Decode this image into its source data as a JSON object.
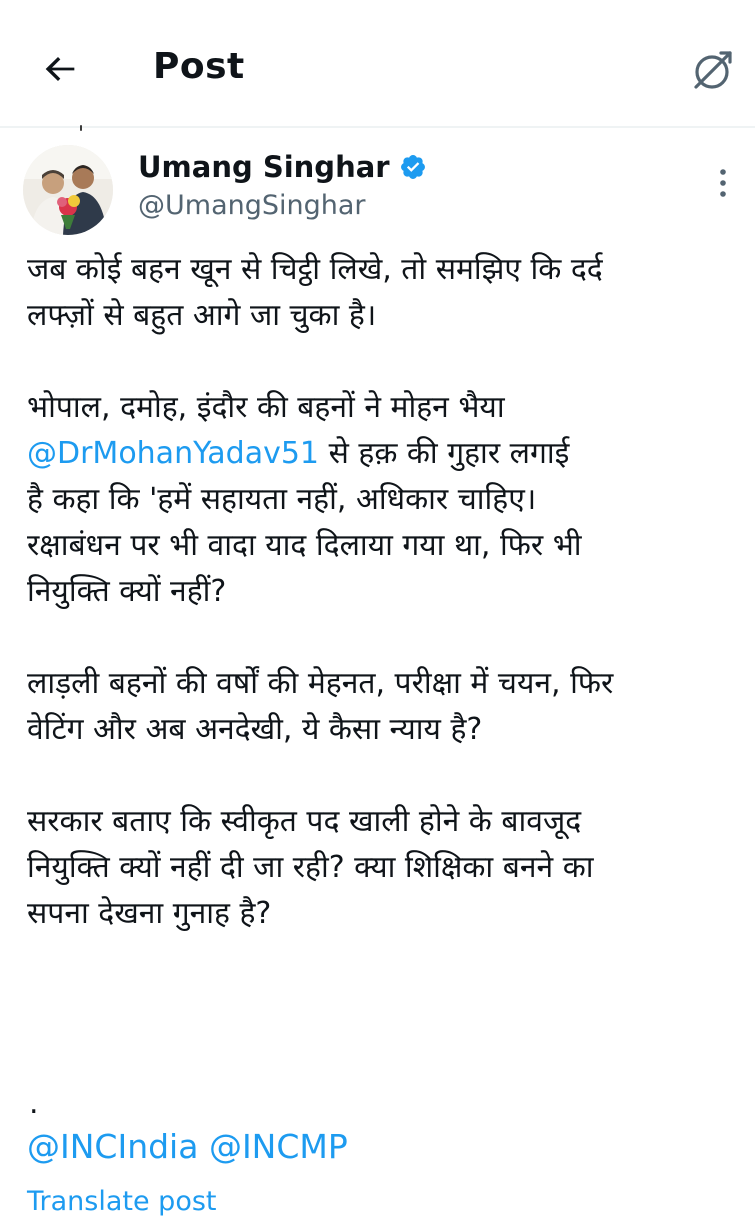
{
  "header": {
    "title": "Post",
    "back_icon": "arrow-left-icon",
    "grok_icon": "grok-icon"
  },
  "author": {
    "name": "Umang Singhar",
    "handle": "@UmangSinghar",
    "verified_color": "#1d9bf0"
  },
  "tweet": {
    "p1": "जब कोई बहन खून से चिट्ठी लिखे, तो समझिए कि दर्द\nलफ्ज़ों से बहुत आगे जा चुका है।",
    "p2_before": "भोपाल, दमोह, इंदौर की बहनों ने मोहन भैया\n",
    "p2_mention": "@DrMohanYadav51",
    "p2_after": " से हक़ की गुहार लगाई\nहै कहा कि 'हमें सहायता नहीं, अधिकार चाहिए।\nरक्षाबंधन पर भी वादा याद दिलाया गया था, फिर भी\nनियुक्ति क्यों नहीं?",
    "p3": "लाड़ली बहनों की वर्षों की मेहनत, परीक्षा में चयन, फिर\nवेटिंग और अब अनदेखी, ये कैसा न्याय है?",
    "p4": "सरकार बताए कि स्वीकृत पद खाली होने के बावजूद\nनियुक्ति क्यों नहीं दी जा रही? क्या शिक्षिका बनने का\nसपना देखना गुनाह है?",
    "dot": ".",
    "mention_1": "@INCIndia",
    "mention_2": "@INCMP",
    "translate": "Translate post"
  },
  "colors": {
    "link": "#1d9bf0",
    "text": "#0f1419",
    "secondary": "#536471"
  }
}
